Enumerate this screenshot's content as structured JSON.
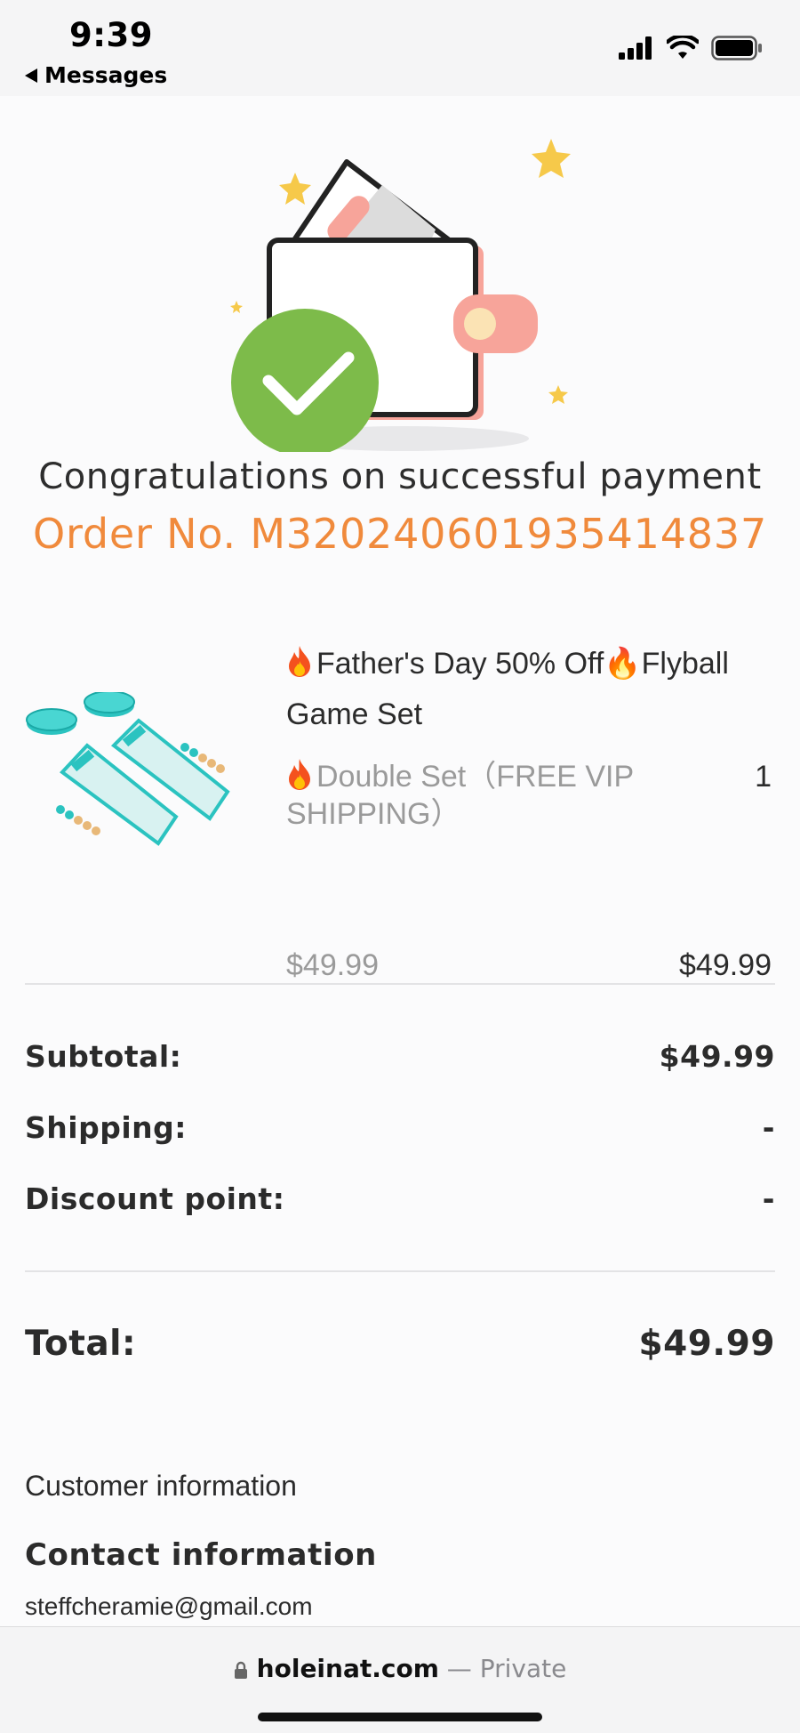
{
  "status_bar": {
    "time": "9:39",
    "back_label": "Messages",
    "icons": [
      "signal-icon",
      "wifi-icon",
      "battery-icon"
    ]
  },
  "confirmation": {
    "headline": "Congratulations on successful payment",
    "order_number": "Order No. M320240601935414837"
  },
  "product": {
    "title": "Father's Day 50% Off🔥Flyball Game Set",
    "title_prefix_icon": "fire-icon",
    "variant": "Double Set（FREE VIP SHIPPING）",
    "variant_prefix_icon": "fire-icon",
    "quantity": "1",
    "unit_price": "$49.99",
    "line_total": "$49.99"
  },
  "summary": {
    "subtotal_label": "Subtotal:",
    "subtotal_value": "$49.99",
    "shipping_label": "Shipping:",
    "shipping_value": "-",
    "discount_label": "Discount point:",
    "discount_value": "-",
    "total_label": "Total:",
    "total_value": "$49.99"
  },
  "customer": {
    "section_title": "Customer information",
    "contact_title": "Contact information",
    "email": "steffcheramie@gmail.com"
  },
  "browser": {
    "domain": "holeinat.com",
    "separator": " — ",
    "private_label": "Private"
  },
  "colors": {
    "accent_orange": "#f08a3c",
    "success_green": "#7dbb4a",
    "wallet_pink": "#f7a49a"
  }
}
